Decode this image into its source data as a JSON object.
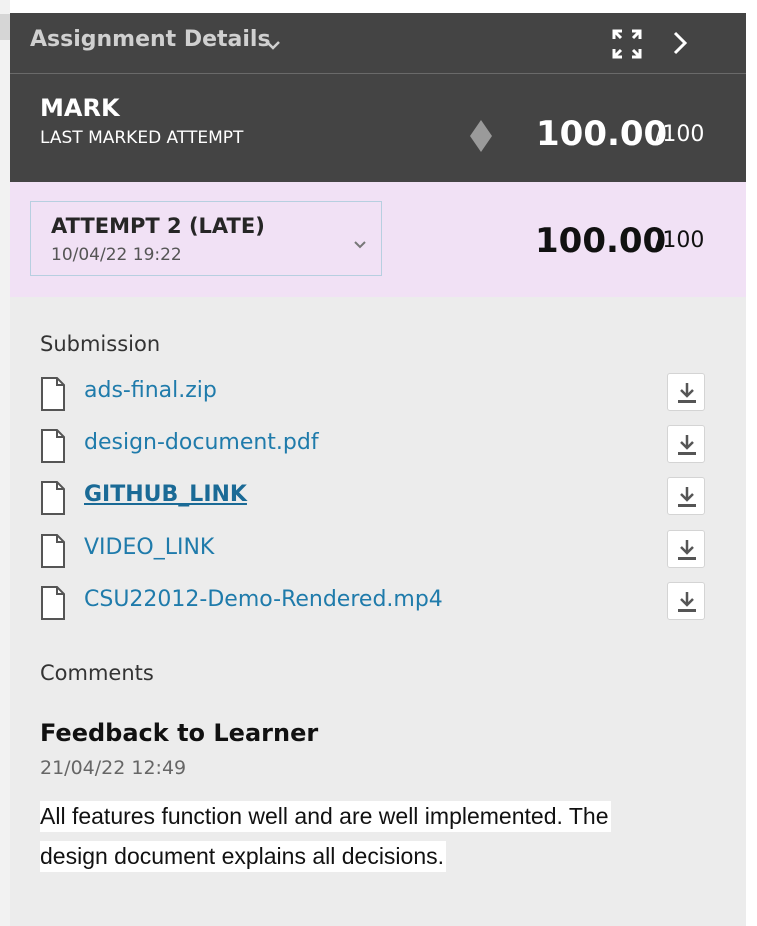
{
  "header": {
    "title": "Assignment Details",
    "icons": [
      "chevron-down-icon",
      "expand-icon",
      "chevron-right-icon"
    ]
  },
  "mark": {
    "label": "MARK",
    "sublabel": "LAST MARKED ATTEMPT",
    "score": "100.00",
    "out_of": "/100"
  },
  "attempt": {
    "title": "ATTEMPT 2 (LATE)",
    "date": "10/04/22 19:22",
    "score": "100.00",
    "out_of": "/100"
  },
  "submission": {
    "label": "Submission",
    "files": [
      {
        "name": "ads-final.zip"
      },
      {
        "name": "design-document.pdf"
      },
      {
        "name": "GITHUB_LINK"
      },
      {
        "name": "VIDEO_LINK"
      },
      {
        "name": "CSU22012-Demo-Rendered.mp4"
      }
    ]
  },
  "comments": {
    "label": "Comments",
    "feedback_title": "Feedback to Learner",
    "date": "21/04/22 12:49",
    "line1": "All features function well and are well implemented. The",
    "line2": "design document explains all decisions."
  },
  "colors": {
    "header_bg": "#444444",
    "attempt_bg": "#f1e1f5",
    "panel_bg": "#ececec",
    "link": "#1f7bab"
  }
}
